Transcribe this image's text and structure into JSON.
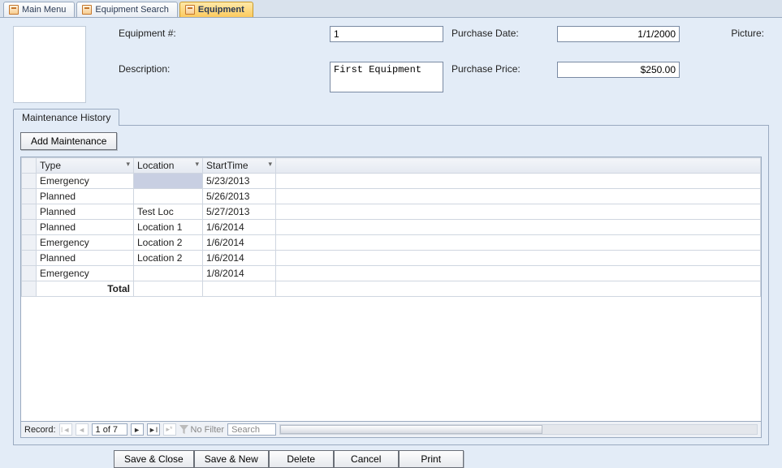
{
  "tabs": [
    {
      "label": "Main Menu",
      "active": false
    },
    {
      "label": "Equipment Search",
      "active": false
    },
    {
      "label": "Equipment",
      "active": true
    }
  ],
  "form": {
    "equipment_num_label": "Equipment #:",
    "equipment_num_value": "1",
    "description_label": "Description:",
    "description_value": "First Equipment",
    "purchase_date_label": "Purchase Date:",
    "purchase_date_value": "1/1/2000",
    "purchase_price_label": "Purchase Price:",
    "purchase_price_value": "$250.00",
    "picture_label": "Picture:"
  },
  "subform": {
    "tab_label": "Maintenance History",
    "add_button": "Add Maintenance",
    "columns": {
      "type": "Type",
      "location": "Location",
      "start": "StartTime"
    },
    "rows": [
      {
        "type": "Emergency",
        "location": "",
        "start": "5/23/2013",
        "selected": true
      },
      {
        "type": "Planned",
        "location": "",
        "start": "5/26/2013"
      },
      {
        "type": "Planned",
        "location": "Test Loc",
        "start": "5/27/2013"
      },
      {
        "type": "Planned",
        "location": "Location 1",
        "start": "1/6/2014"
      },
      {
        "type": "Emergency",
        "location": "Location 2",
        "start": "1/6/2014"
      },
      {
        "type": "Planned",
        "location": "Location 2",
        "start": "1/6/2014"
      },
      {
        "type": "Emergency",
        "location": "",
        "start": "1/8/2014"
      }
    ],
    "total_label": "Total"
  },
  "recordnav": {
    "label": "Record:",
    "position": "1 of 7",
    "nofilter": "No Filter",
    "search_placeholder": "Search"
  },
  "footer": {
    "save_close": "Save & Close",
    "save_new": "Save & New",
    "delete": "Delete",
    "cancel": "Cancel",
    "print": "Print"
  }
}
